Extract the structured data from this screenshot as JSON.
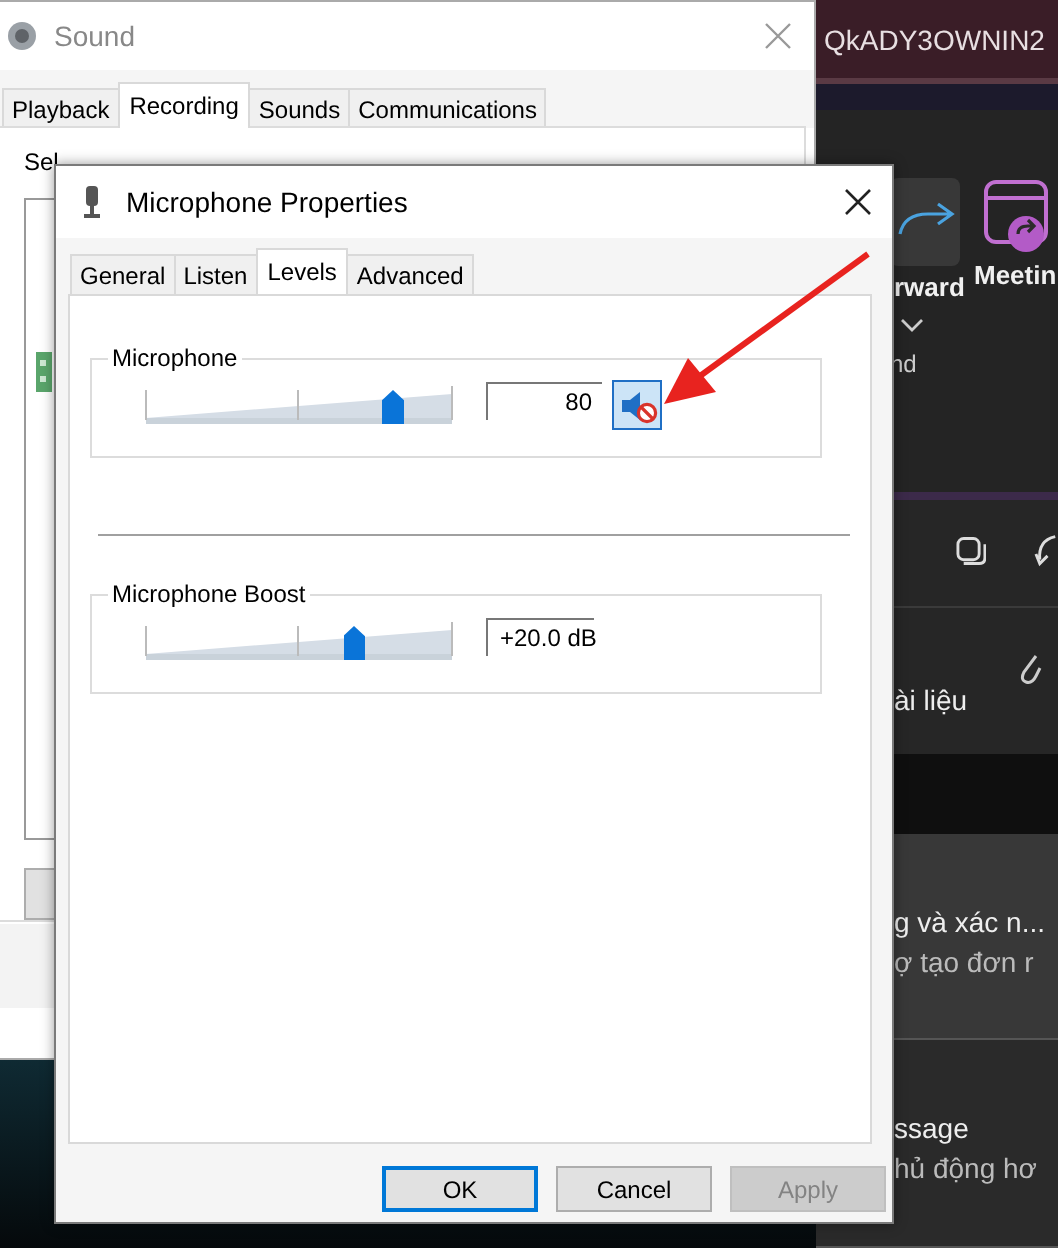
{
  "sound_window": {
    "title": "Sound",
    "tabs": [
      {
        "label": "Playback",
        "selected": false
      },
      {
        "label": "Recording",
        "selected": true
      },
      {
        "label": "Sounds",
        "selected": false
      },
      {
        "label": "Communications",
        "selected": false
      }
    ],
    "instruction": "Sel"
  },
  "background_app": {
    "header_text": "QkADY3OWNIN2",
    "ribbon": [
      {
        "label": "rward",
        "kind": "forward"
      },
      {
        "label": "Meetin",
        "kind": "meeting"
      }
    ],
    "ribbon_caption": "nd",
    "attachment_label": "ài liệu",
    "messages": [
      {
        "title": "g và xác n...",
        "preview": "ợ tạo đơn r",
        "selected": true
      },
      {
        "title": "ssage",
        "preview": "hủ động hơ",
        "selected": false
      }
    ]
  },
  "dialog": {
    "title": "Microphone Properties",
    "tabs": [
      {
        "label": "General",
        "selected": false
      },
      {
        "label": "Listen",
        "selected": false
      },
      {
        "label": "Levels",
        "selected": true
      },
      {
        "label": "Advanced",
        "selected": false
      }
    ],
    "levels": [
      {
        "label": "Microphone",
        "kind": "volume",
        "level": 0.8,
        "value": "80",
        "muted": true
      },
      {
        "label": "Microphone Boost",
        "kind": "boost",
        "level": 0.67,
        "value": "+20.0 dB"
      }
    ],
    "buttons": [
      {
        "label": "OK",
        "kind": "default",
        "disabled": false
      },
      {
        "label": "Cancel",
        "kind": "normal",
        "disabled": false
      },
      {
        "label": "Apply",
        "kind": "normal",
        "disabled": true
      }
    ]
  }
}
